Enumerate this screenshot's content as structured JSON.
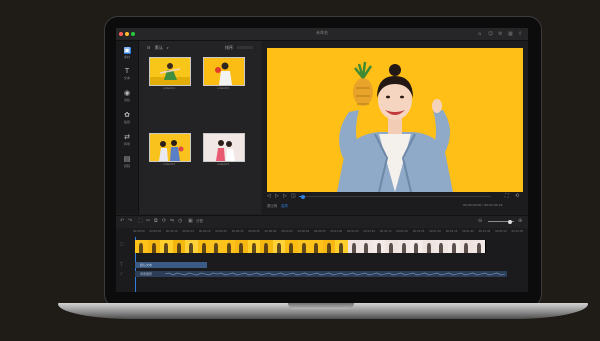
{
  "app": {
    "window_title": "未命名"
  },
  "sidebar": {
    "items": [
      {
        "label": "素材",
        "icon": "media-icon",
        "active": true
      },
      {
        "label": "文本",
        "icon": "text-icon",
        "active": false
      },
      {
        "label": "滤镜",
        "icon": "filter-icon",
        "active": false
      },
      {
        "label": "贴纸",
        "icon": "sticker-icon",
        "active": false
      },
      {
        "label": "转场",
        "icon": "transition-icon",
        "active": false
      },
      {
        "label": "视频",
        "icon": "video-icon",
        "active": false
      }
    ]
  },
  "media": {
    "folder_label": "默认",
    "sort_label": "排序",
    "items": [
      {
        "caption": "video01"
      },
      {
        "caption": "video02"
      },
      {
        "caption": "video03"
      },
      {
        "caption": "video04"
      }
    ]
  },
  "preview": {
    "ratio_label": "原比例",
    "quality_label": "高清",
    "timecode": "00:00:00:00 / 00:01:02:22",
    "progress": 0.02
  },
  "toolbar": {
    "split_label": "分割"
  },
  "timeline": {
    "ticks": [
      "00:00:00",
      "00:00:05",
      "00:00:10",
      "00:00:15",
      "00:00:20",
      "00:00:25",
      "00:00:30",
      "00:00:35",
      "00:00:40",
      "00:00:45",
      "00:00:50",
      "00:00:55",
      "00:01:00",
      "00:01:05",
      "00:01:10",
      "00:01:15",
      "00:01:20",
      "00:01:25",
      "00:01:30",
      "00:01:35",
      "00:01:40",
      "00:01:45",
      "00:01:50",
      "00:01:55"
    ],
    "text_track_label": "默认文本",
    "audio_track_label": "背景音乐"
  },
  "colors": {
    "accent": "#2f7fe0",
    "clip_yellow": "#ffc21a",
    "player_bg": "#ffbf16"
  }
}
